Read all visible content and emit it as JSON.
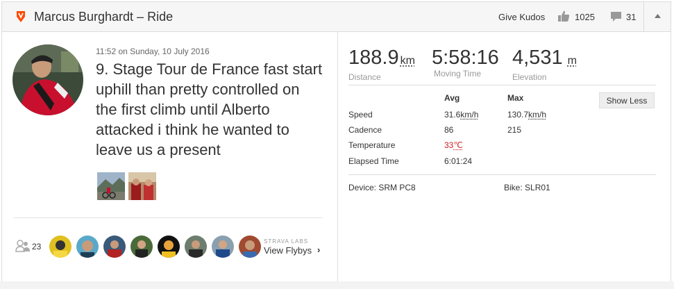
{
  "header": {
    "title": "Marcus Burghardt – Ride",
    "give_kudos": "Give Kudos",
    "kudos_count": "1025",
    "comment_count": "31",
    "brand_color": "#fc4c02"
  },
  "activity": {
    "date": "11:52 on Sunday, 10 July 2016",
    "description": "9. Stage Tour de France fast start uphill than pretty controlled on the first climb until Alberto attacked i think he wanted to leave us a present"
  },
  "social": {
    "kudoers_count": "23",
    "labs_label": "STRAVA LABS",
    "flyby_label": "View Flybys",
    "flyby_chevron": "›"
  },
  "stats": {
    "distance": {
      "value": "188.9",
      "unit": "km",
      "label": "Distance"
    },
    "moving_time": {
      "value": "5:58:16",
      "label": "Moving Time"
    },
    "elevation": {
      "value": "4,531",
      "unit": "m",
      "label": "Elevation"
    }
  },
  "details": {
    "avg_header": "Avg",
    "max_header": "Max",
    "show_less": "Show Less",
    "rows": [
      {
        "label": "Speed",
        "avg": "31.6",
        "avg_unit": "km/h",
        "max": "130.7",
        "max_unit": "km/h"
      },
      {
        "label": "Cadence",
        "avg": "86",
        "max": "215"
      },
      {
        "label": "Temperature",
        "avg": "33",
        "avg_unit": "℃"
      },
      {
        "label": "Elapsed Time",
        "avg": "6:01:24"
      }
    ],
    "device": "Device: SRM PC8",
    "bike": "Bike: SLR01"
  }
}
